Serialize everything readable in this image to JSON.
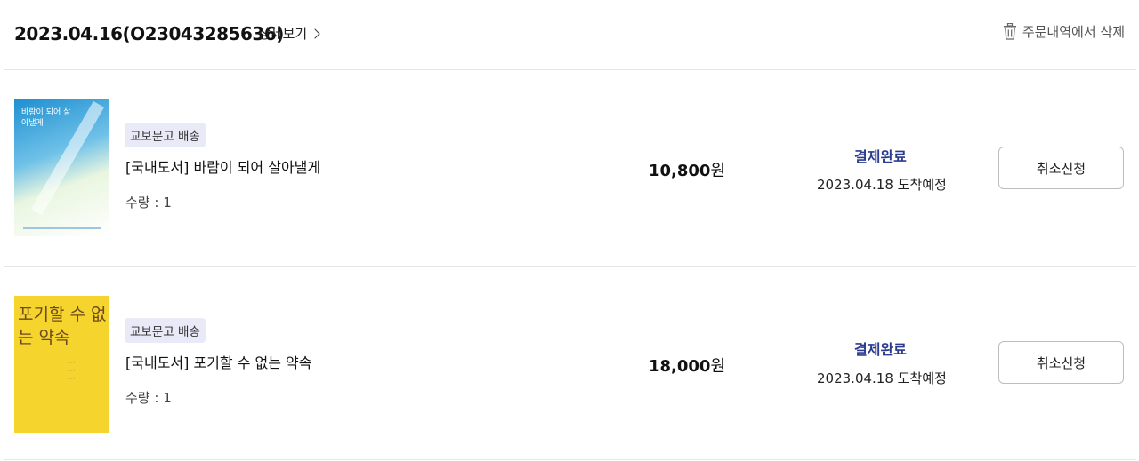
{
  "order": {
    "date_id": "2023.04.16(O23043285636)",
    "detail_label": "상세보기",
    "delete_label": "주문내역에서 삭제"
  },
  "items": [
    {
      "badge": "교보문고 배송",
      "title": "[국내도서] 바람이 되어 살아낼게",
      "quantity": "수량 : 1",
      "price": "10,800",
      "currency": "원",
      "status": "결제완료",
      "eta": "2023.04.18 도착예정",
      "cancel_label": "취소신청",
      "cover_text": "바람이 되어 살아낼게"
    },
    {
      "badge": "교보문고 배송",
      "title": "[국내도서] 포기할 수 없는 약속",
      "quantity": "수량 : 1",
      "price": "18,000",
      "currency": "원",
      "status": "결제완료",
      "eta": "2023.04.18 도착예정",
      "cancel_label": "취소신청",
      "cover_text": "포기할 수 없는 약속"
    }
  ],
  "colors": {
    "status": "#2b3b8f",
    "badge_bg": "#e9eaf7",
    "divider": "#e6e6e6"
  }
}
